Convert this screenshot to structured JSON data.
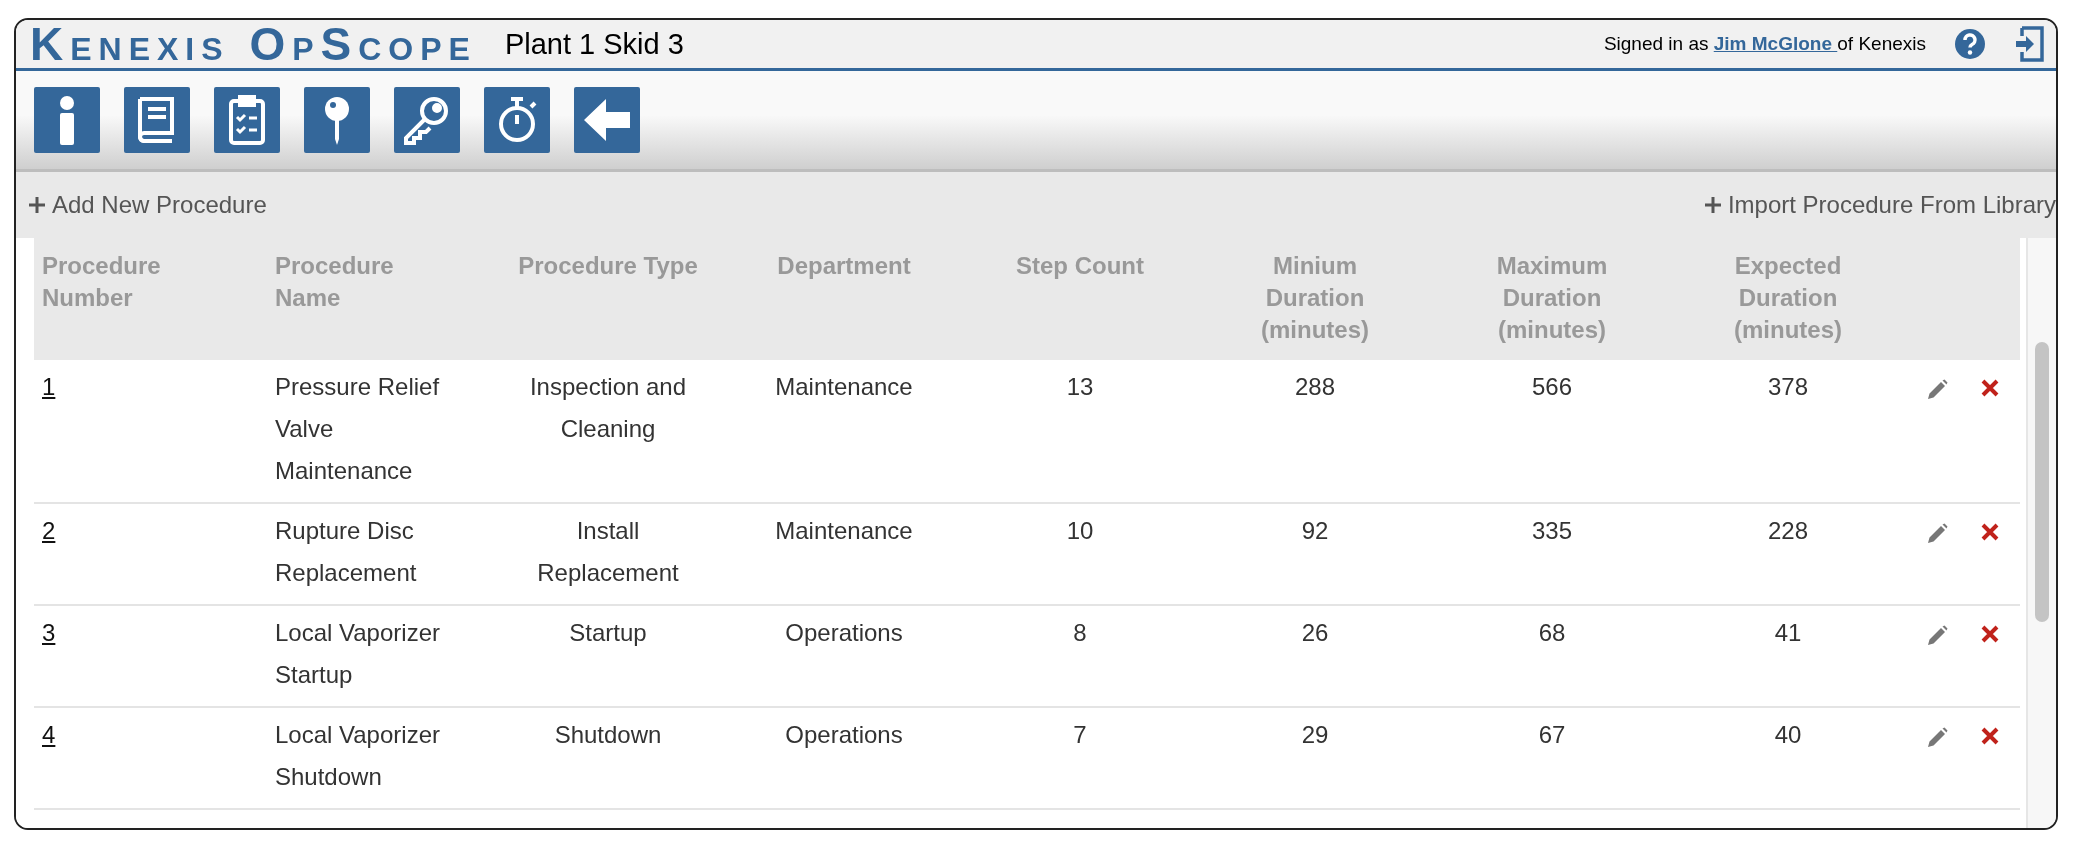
{
  "header": {
    "logo": "Kenexis OpScope",
    "location": "Plant 1 Skid 3",
    "signed_in_prefix": "Signed in as",
    "user": "Jim McGlone ",
    "signed_in_suffix": "of Kenexis"
  },
  "actions": {
    "add": "Add New Procedure",
    "import": "Import Procedure From Library"
  },
  "table": {
    "columns": [
      "Procedure Number",
      "Procedure Name",
      "Procedure Type",
      "Department",
      "Step Count",
      "Minium Duration (minutes)",
      "Maximum Duration (minutes)",
      "Expected Duration (minutes)"
    ],
    "rows": [
      {
        "number": "1",
        "name": "Pressure Relief Valve Maintenance",
        "type": "Inspection and Cleaning",
        "department": "Maintenance",
        "steps": "13",
        "min": "288",
        "max": "566",
        "expected": "378"
      },
      {
        "number": "2",
        "name": "Rupture Disc Replacement",
        "type": "Install Replacement",
        "department": "Maintenance",
        "steps": "10",
        "min": "92",
        "max": "335",
        "expected": "228"
      },
      {
        "number": "3",
        "name": "Local Vaporizer Startup",
        "type": "Startup",
        "department": "Operations",
        "steps": "8",
        "min": "26",
        "max": "68",
        "expected": "41"
      },
      {
        "number": "4",
        "name": "Local Vaporizer Shutdown",
        "type": "Shutdown",
        "department": "Operations",
        "steps": "7",
        "min": "29",
        "max": "67",
        "expected": "40"
      }
    ]
  }
}
